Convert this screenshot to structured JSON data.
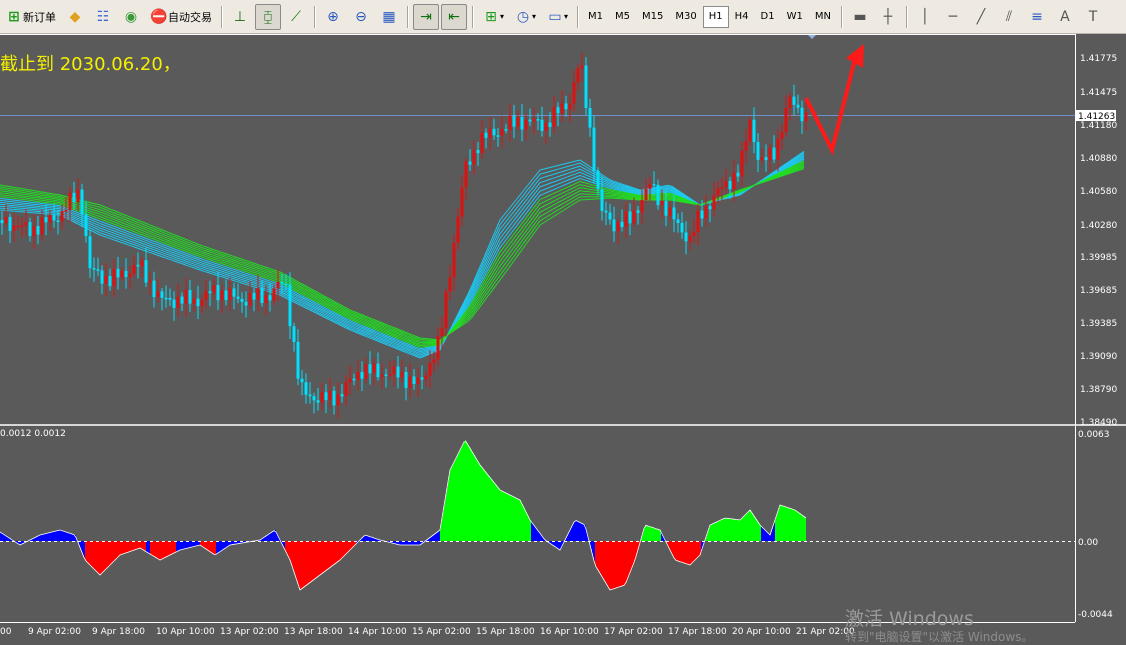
{
  "toolbar": {
    "new_order": "新订单",
    "auto_trading": "自动交易",
    "timeframes": [
      "M1",
      "M5",
      "M15",
      "M30",
      "H1",
      "H4",
      "D1",
      "W1",
      "MN"
    ],
    "active_timeframe": "H1"
  },
  "chart": {
    "annotation": "截止到 2030.06.20，",
    "price_ticks": [
      "1.41775",
      "1.41475",
      "1.41180",
      "1.40880",
      "1.40580",
      "1.40280",
      "1.39985",
      "1.39685",
      "1.39385",
      "1.39090",
      "1.38790",
      "1.38490"
    ],
    "current_price": "1.41263",
    "time_ticks": [
      "00",
      "9 Apr 02:00",
      "9 Apr 18:00",
      "10 Apr 10:00",
      "13 Apr 02:00",
      "13 Apr 18:00",
      "14 Apr 10:00",
      "15 Apr 02:00",
      "15 Apr 18:00",
      "16 Apr 10:00",
      "17 Apr 02:00",
      "17 Apr 18:00",
      "20 Apr 10:00",
      "21 Apr 02:00"
    ],
    "colors": {
      "bull": "#e01010",
      "bear": "#00e0ff",
      "background": "#5a5a5a",
      "ma_fast": "#1ec8f0",
      "ma_slow": "#22dd22",
      "arrow": "#ff1a1a"
    }
  },
  "indicator": {
    "label": "0.0012 0.0012",
    "ticks": [
      "0.0063",
      "0.00",
      "-0.0044"
    ],
    "colors": {
      "positive_strong": "#00ff00",
      "negative_strong": "#ff0000",
      "weak": "#0000ff"
    }
  },
  "watermark": {
    "line1": "激活 Windows",
    "line2": "转到\"电脑设置\"以激活 Windows。"
  }
}
